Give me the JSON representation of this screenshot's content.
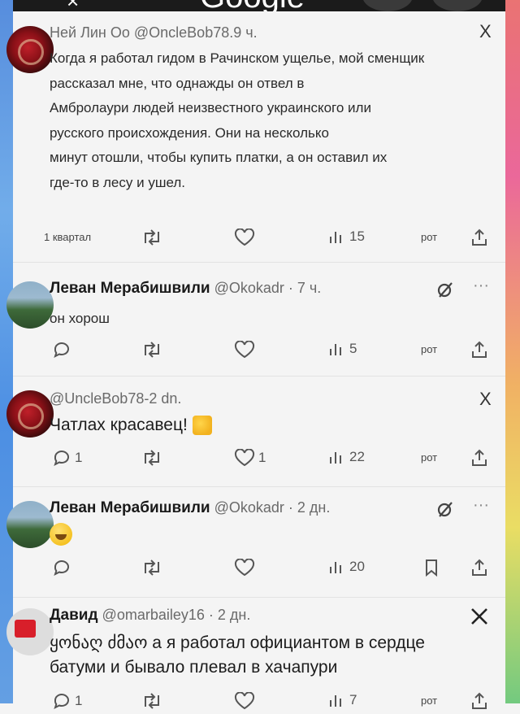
{
  "top_bar": {
    "brand": "Google"
  },
  "tweets": [
    {
      "header": "Ней Лин Оо @OncleBob78.9 ч.",
      "close": "X",
      "lines": [
        "Когда я работал гидом в Рачинском ущелье, мой сменщик",
        "рассказал мне, что однажды он отвел в",
        "Амбролаури людей неизвестного украинского или",
        "русского происхождения. Они на несколько",
        "минут отошли, чтобы купить платки, а он оставил их",
        "где-то в лесу и ушел."
      ],
      "reply_label": "1 квартал",
      "views": "15",
      "bookmark_label": "рот"
    },
    {
      "name": "Леван Мерабишвили",
      "handle": "@Okokadr · 7 ч.",
      "text": "он хорош",
      "views": "5",
      "bookmark_label": "рот"
    },
    {
      "header": "@UncleBob78-2 dn.",
      "close": "X",
      "text": "Чатлах красавец!",
      "reply_count": "1",
      "like_count": "1",
      "views": "22",
      "bookmark_label": "рот"
    },
    {
      "name": "Леван Мерабишвили",
      "handle": "@Okokadr · 2 дн.",
      "views": "20"
    },
    {
      "name": "Давид",
      "handle": "@omarbailey16 · 2 дн.",
      "text_lines": [
        "ყონაღ ძმაო а я работал официантом в сердце",
        "батуми и бывало плевал в хачапури"
      ],
      "reply_count": "1",
      "views": "7",
      "bookmark_label": "рот"
    }
  ]
}
